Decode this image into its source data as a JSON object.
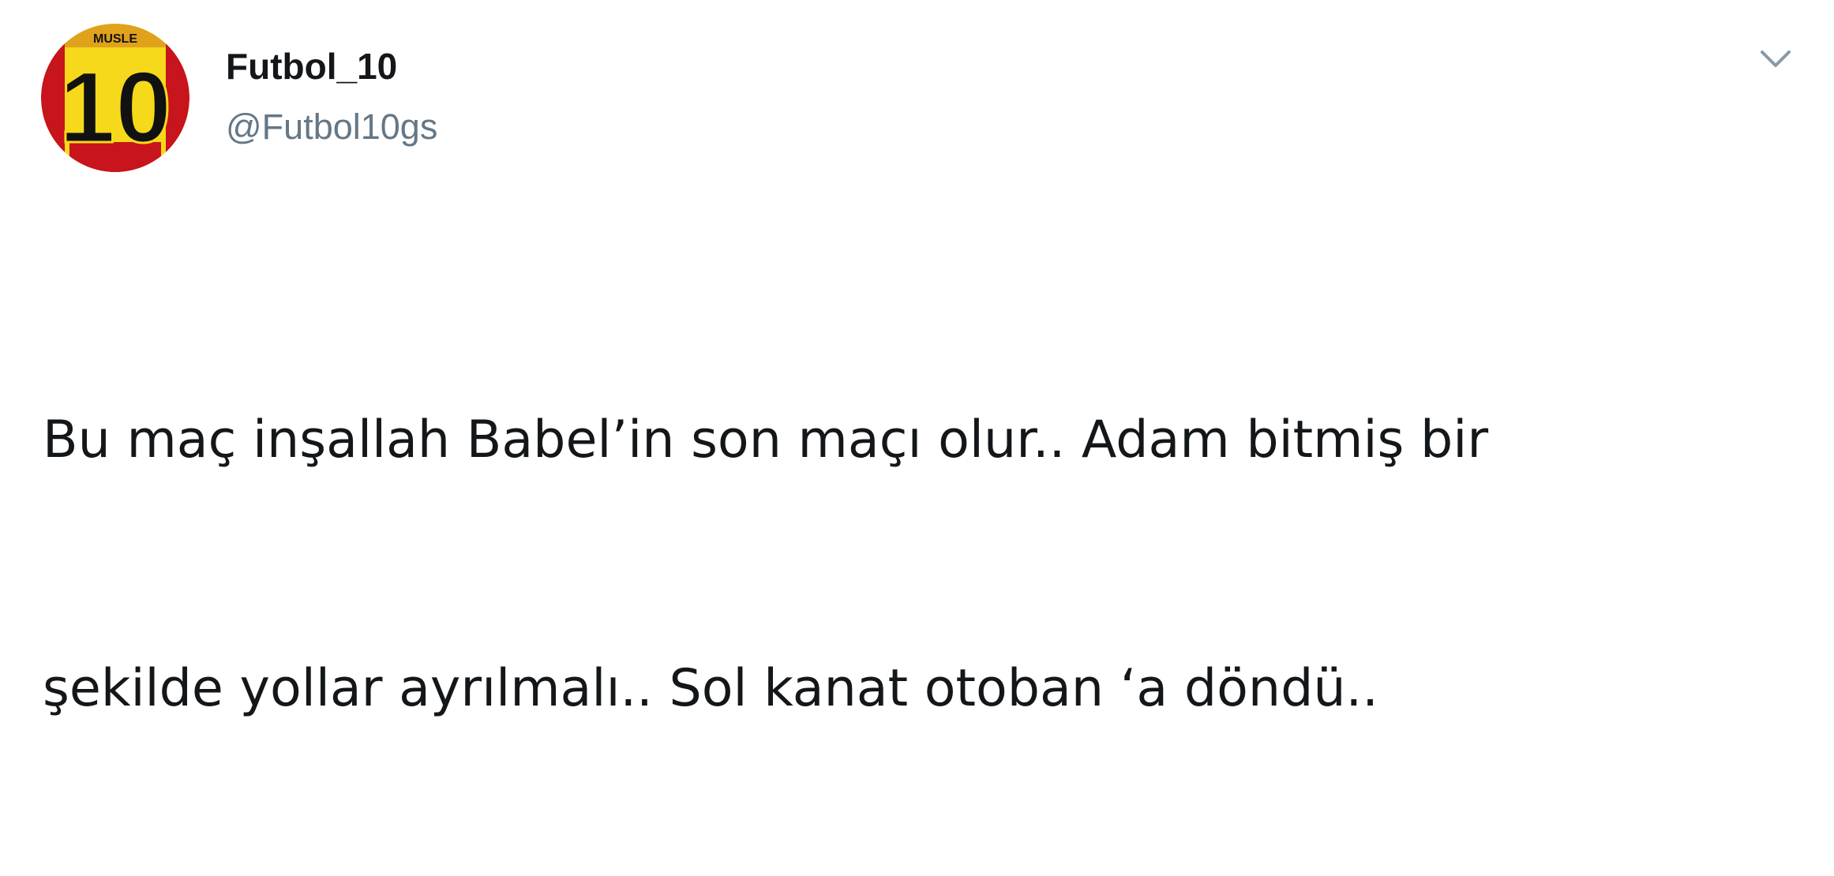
{
  "tweet": {
    "author": {
      "display_name": "Futbol_10",
      "handle": "@Futbol10gs",
      "avatar_number": "10",
      "avatar_colors": {
        "red": "#c8141c",
        "yellow": "#f5d91a",
        "black": "#111111"
      }
    },
    "text_lines": [
      "Bu maç inşallah Babel’in son maçı olur.. Adam bitmiş bir",
      "şekilde yollar ayrılmalı.. Sol kanat otoban ‘a döndü.."
    ],
    "menu_icon": "chevron-down-icon"
  },
  "colors": {
    "text_primary": "#14171a",
    "text_secondary": "#657786",
    "icon": "#8899a6",
    "background": "#ffffff"
  }
}
